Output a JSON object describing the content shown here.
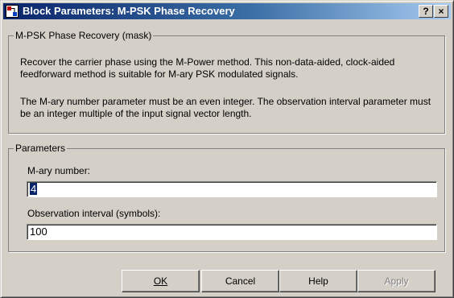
{
  "window": {
    "title": "Block Parameters: M-PSK Phase Recovery",
    "help_glyph": "?",
    "close_glyph": "×"
  },
  "mask": {
    "legend": "M-PSK Phase Recovery (mask)",
    "description_1": "Recover the carrier phase using the M-Power method.  This non-data-aided, clock-aided feedforward method is suitable for M-ary PSK modulated signals.",
    "description_2": "The M-ary number parameter must be an even integer. The observation interval parameter must be an integer multiple of the input signal vector length."
  },
  "parameters": {
    "legend": "Parameters",
    "m_ary": {
      "label": "M-ary number:",
      "value": "4"
    },
    "observation": {
      "label": "Observation interval (symbols):",
      "value": "100"
    }
  },
  "buttons": {
    "ok": "OK",
    "cancel": "Cancel",
    "help": "Help",
    "apply": "Apply"
  }
}
